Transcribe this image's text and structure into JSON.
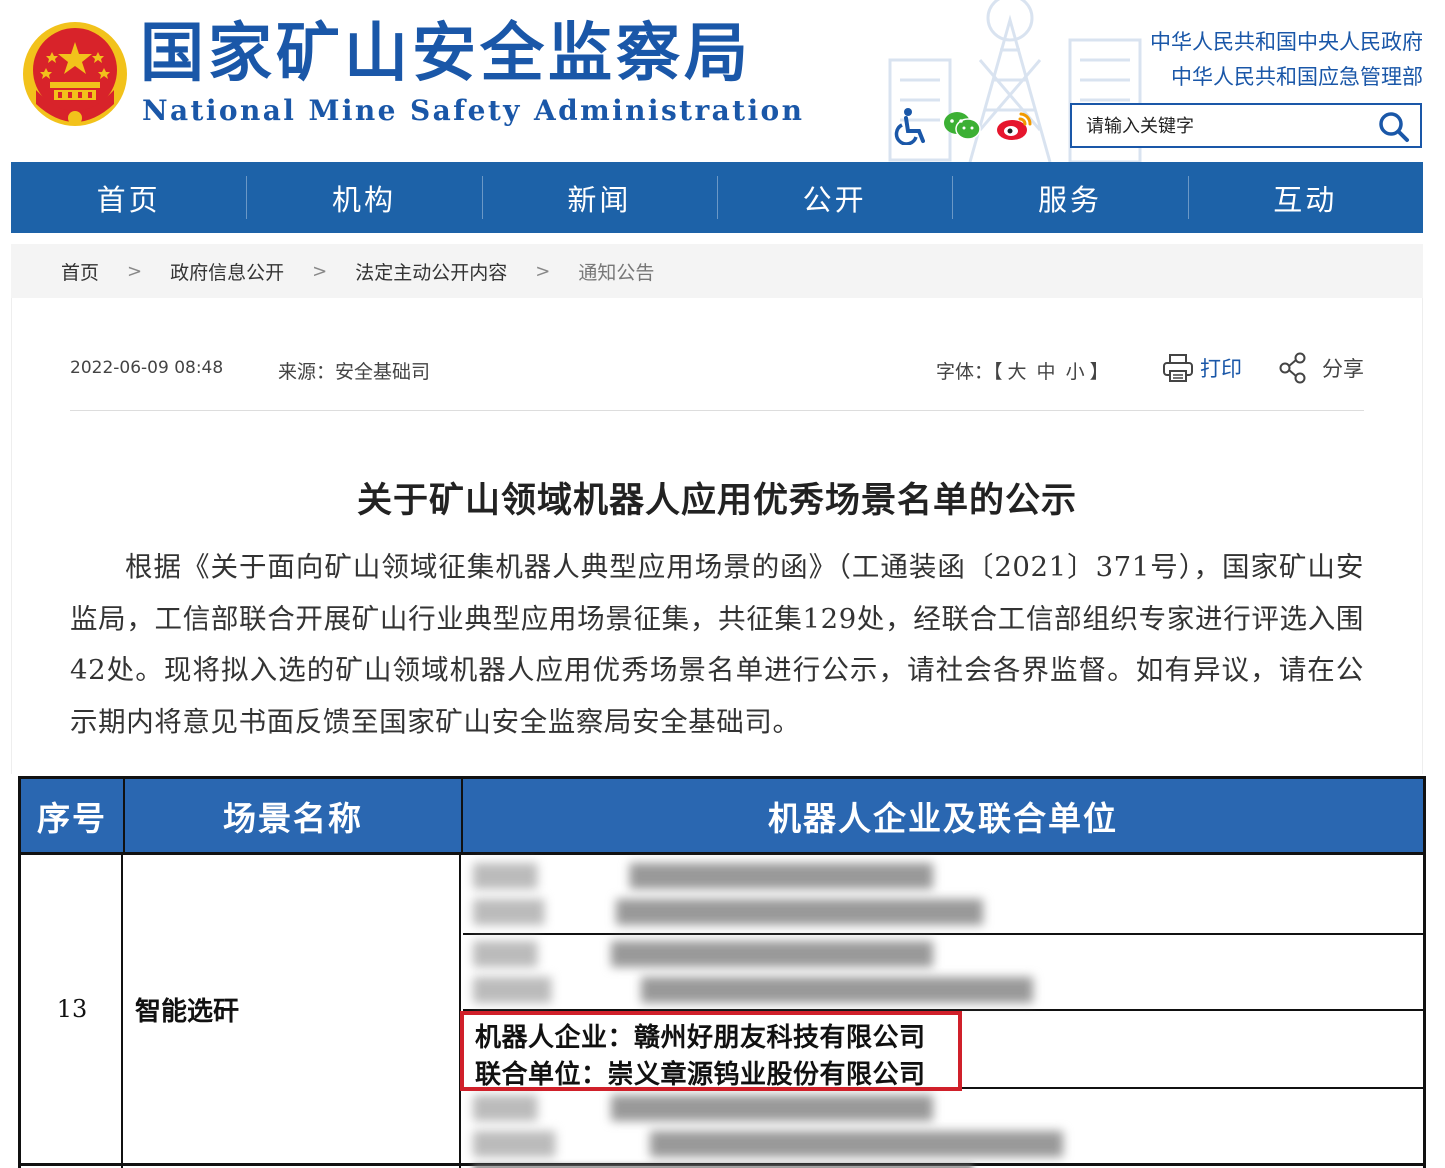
{
  "header": {
    "title": "国家矿山安全监察局",
    "subtitle": "National Mine Safety Administration",
    "gov_links": [
      "中华人民共和国中央人民政府",
      "中华人民共和国应急管理部"
    ],
    "search": {
      "placeholder": "请输入关键字"
    },
    "icons": [
      "accessibility-icon",
      "wechat-icon",
      "weibo-icon",
      "search-icon"
    ]
  },
  "nav": {
    "items": [
      "首页",
      "机构",
      "新闻",
      "公开",
      "服务",
      "互动"
    ]
  },
  "breadcrumb": {
    "items": [
      "首页",
      "政府信息公开",
      "法定主动公开内容",
      "通知公告"
    ],
    "separator": ">"
  },
  "article": {
    "date": "2022-06-09 08:48",
    "source": "来源：安全基础司",
    "font_label": "字体：",
    "font_open": "【",
    "font_sizes": [
      "大",
      "中",
      "小"
    ],
    "font_close": "】",
    "print_label": "打印",
    "share_label": "分享",
    "title": "关于矿山领域机器人应用优秀场景名单的公示",
    "body": "根据《关于面向矿山领域征集机器人典型应用场景的函》（工通装函〔2021〕371号），国家矿山安监局，工信部联合开展矿山行业典型应用场景征集，共征集129处，经联合工信部组织专家进行评选入围42处。现将拟入选的矿山领域机器人应用优秀场景名单进行公示，请社会各界监督。如有异议，请在公示期内将意见书面反馈至国家矿山安全监察局安全基础司。"
  },
  "table": {
    "headers": [
      "序号",
      "场景名称",
      "机器人企业及联合单位"
    ],
    "row": {
      "number": "13",
      "scene": "智能选矸",
      "highlighted_entry": {
        "robot_company": "机器人企业：赣州好朋友科技有限公司",
        "partner": "联合单位：崇义章源钨业股份有限公司"
      }
    }
  },
  "colors": {
    "brand_blue": "#1a57a8",
    "nav_blue": "#1d62a8",
    "table_header_blue": "#2a67b1",
    "highlight_red": "#d0202a",
    "emblem_red": "#d8232a",
    "emblem_gold": "#f2c21b"
  }
}
